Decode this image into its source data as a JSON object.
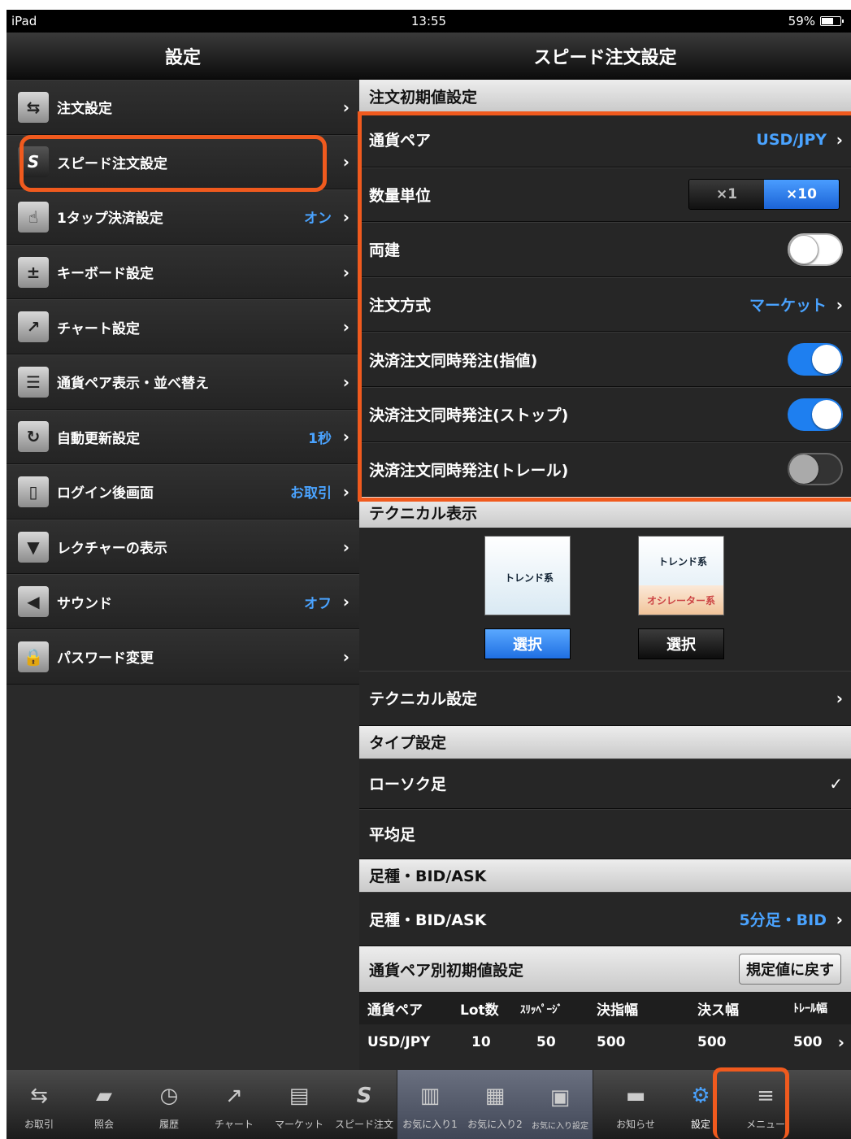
{
  "status_bar": {
    "device": "iPad",
    "time": "13:55",
    "battery": "59%"
  },
  "left_nav": {
    "title": "設定"
  },
  "left_menu": [
    {
      "label": "注文設定",
      "value": "",
      "icon": "swap-icon"
    },
    {
      "label": "スピード注文設定",
      "value": "",
      "icon": "speed-order-icon"
    },
    {
      "label": "1タップ決済設定",
      "value": "オン",
      "icon": "tap-icon"
    },
    {
      "label": "キーボード設定",
      "value": "",
      "icon": "keyboard-icon"
    },
    {
      "label": "チャート設定",
      "value": "",
      "icon": "chart-icon"
    },
    {
      "label": "通貨ペア表示・並べ替え",
      "value": "",
      "icon": "list-icon"
    },
    {
      "label": "自動更新設定",
      "value": "1秒",
      "icon": "refresh-icon"
    },
    {
      "label": "ログイン後画面",
      "value": "お取引",
      "icon": "login-screen-icon"
    },
    {
      "label": "レクチャーの表示",
      "value": "",
      "icon": "lecture-icon"
    },
    {
      "label": "サウンド",
      "value": "オフ",
      "icon": "speaker-icon"
    },
    {
      "label": "パスワード変更",
      "value": "",
      "icon": "lock-icon"
    }
  ],
  "right_nav": {
    "title": "スピード注文設定"
  },
  "order_defaults": {
    "header": "注文初期値設定",
    "currency_pair_label": "通貨ペア",
    "currency_pair_value": "USD/JPY",
    "quantity_unit_label": "数量単位",
    "quantity_options": [
      "×1",
      "×10"
    ],
    "quantity_selected": "×10",
    "hedge_label": "両建",
    "hedge_on": false,
    "order_method_label": "注文方式",
    "order_method_value": "マーケット",
    "limit_label": "決済注文同時発注(指値)",
    "limit_on": true,
    "stop_label": "決済注文同時発注(ストップ)",
    "stop_on": true,
    "trail_label": "決済注文同時発注(トレール)",
    "trail_on": false
  },
  "technical": {
    "header": "テクニカル表示",
    "trend_image_label": "トレンド系",
    "osc_image_top": "トレンド系",
    "osc_image_bottom": "オシレーター系",
    "select_label": "選択",
    "settings_label": "テクニカル設定"
  },
  "type_settings": {
    "header": "タイプ設定",
    "options": [
      "ローソク足",
      "平均足"
    ],
    "selected": "ローソク足"
  },
  "bar_type": {
    "header": "足種・BID/ASK",
    "label": "足種・BID/ASK",
    "value": "5分足・BID"
  },
  "pair_defaults": {
    "header": "通貨ペア別初期値設定",
    "reset_label": "規定値に戻す",
    "columns": [
      "通貨ペア",
      "Lot数",
      "ｽﾘｯﾍﾟｰｼﾞ",
      "決指幅",
      "決ス幅",
      "ﾄﾚｰﾙ幅"
    ],
    "rows": [
      [
        "USD/JPY",
        "10",
        "50",
        "500",
        "500",
        "500"
      ]
    ]
  },
  "tabbar": [
    {
      "label": "お取引",
      "icon": "swap-icon"
    },
    {
      "label": "照会",
      "icon": "folder-icon"
    },
    {
      "label": "履歴",
      "icon": "history-icon"
    },
    {
      "label": "チャート",
      "icon": "chart-icon"
    },
    {
      "label": "マーケット",
      "icon": "market-icon"
    },
    {
      "label": "スピード注文",
      "icon": "speed-order-icon"
    },
    {
      "label": "お気に入り1",
      "icon": "layout-1-icon"
    },
    {
      "label": "お気に入り2",
      "icon": "layout-2-icon"
    },
    {
      "label": "お気に入り設定",
      "icon": "favorites-settings-icon"
    },
    {
      "label": "お知らせ",
      "icon": "speech-bubble-icon"
    },
    {
      "label": "設定",
      "icon": "gear-icon"
    },
    {
      "label": "メニュー",
      "icon": "menu-icon"
    }
  ],
  "colors": {
    "accent_blue": "#4aa3ff",
    "highlight_orange": "#f05a1e",
    "toggle_on": "#1e7ff0"
  }
}
